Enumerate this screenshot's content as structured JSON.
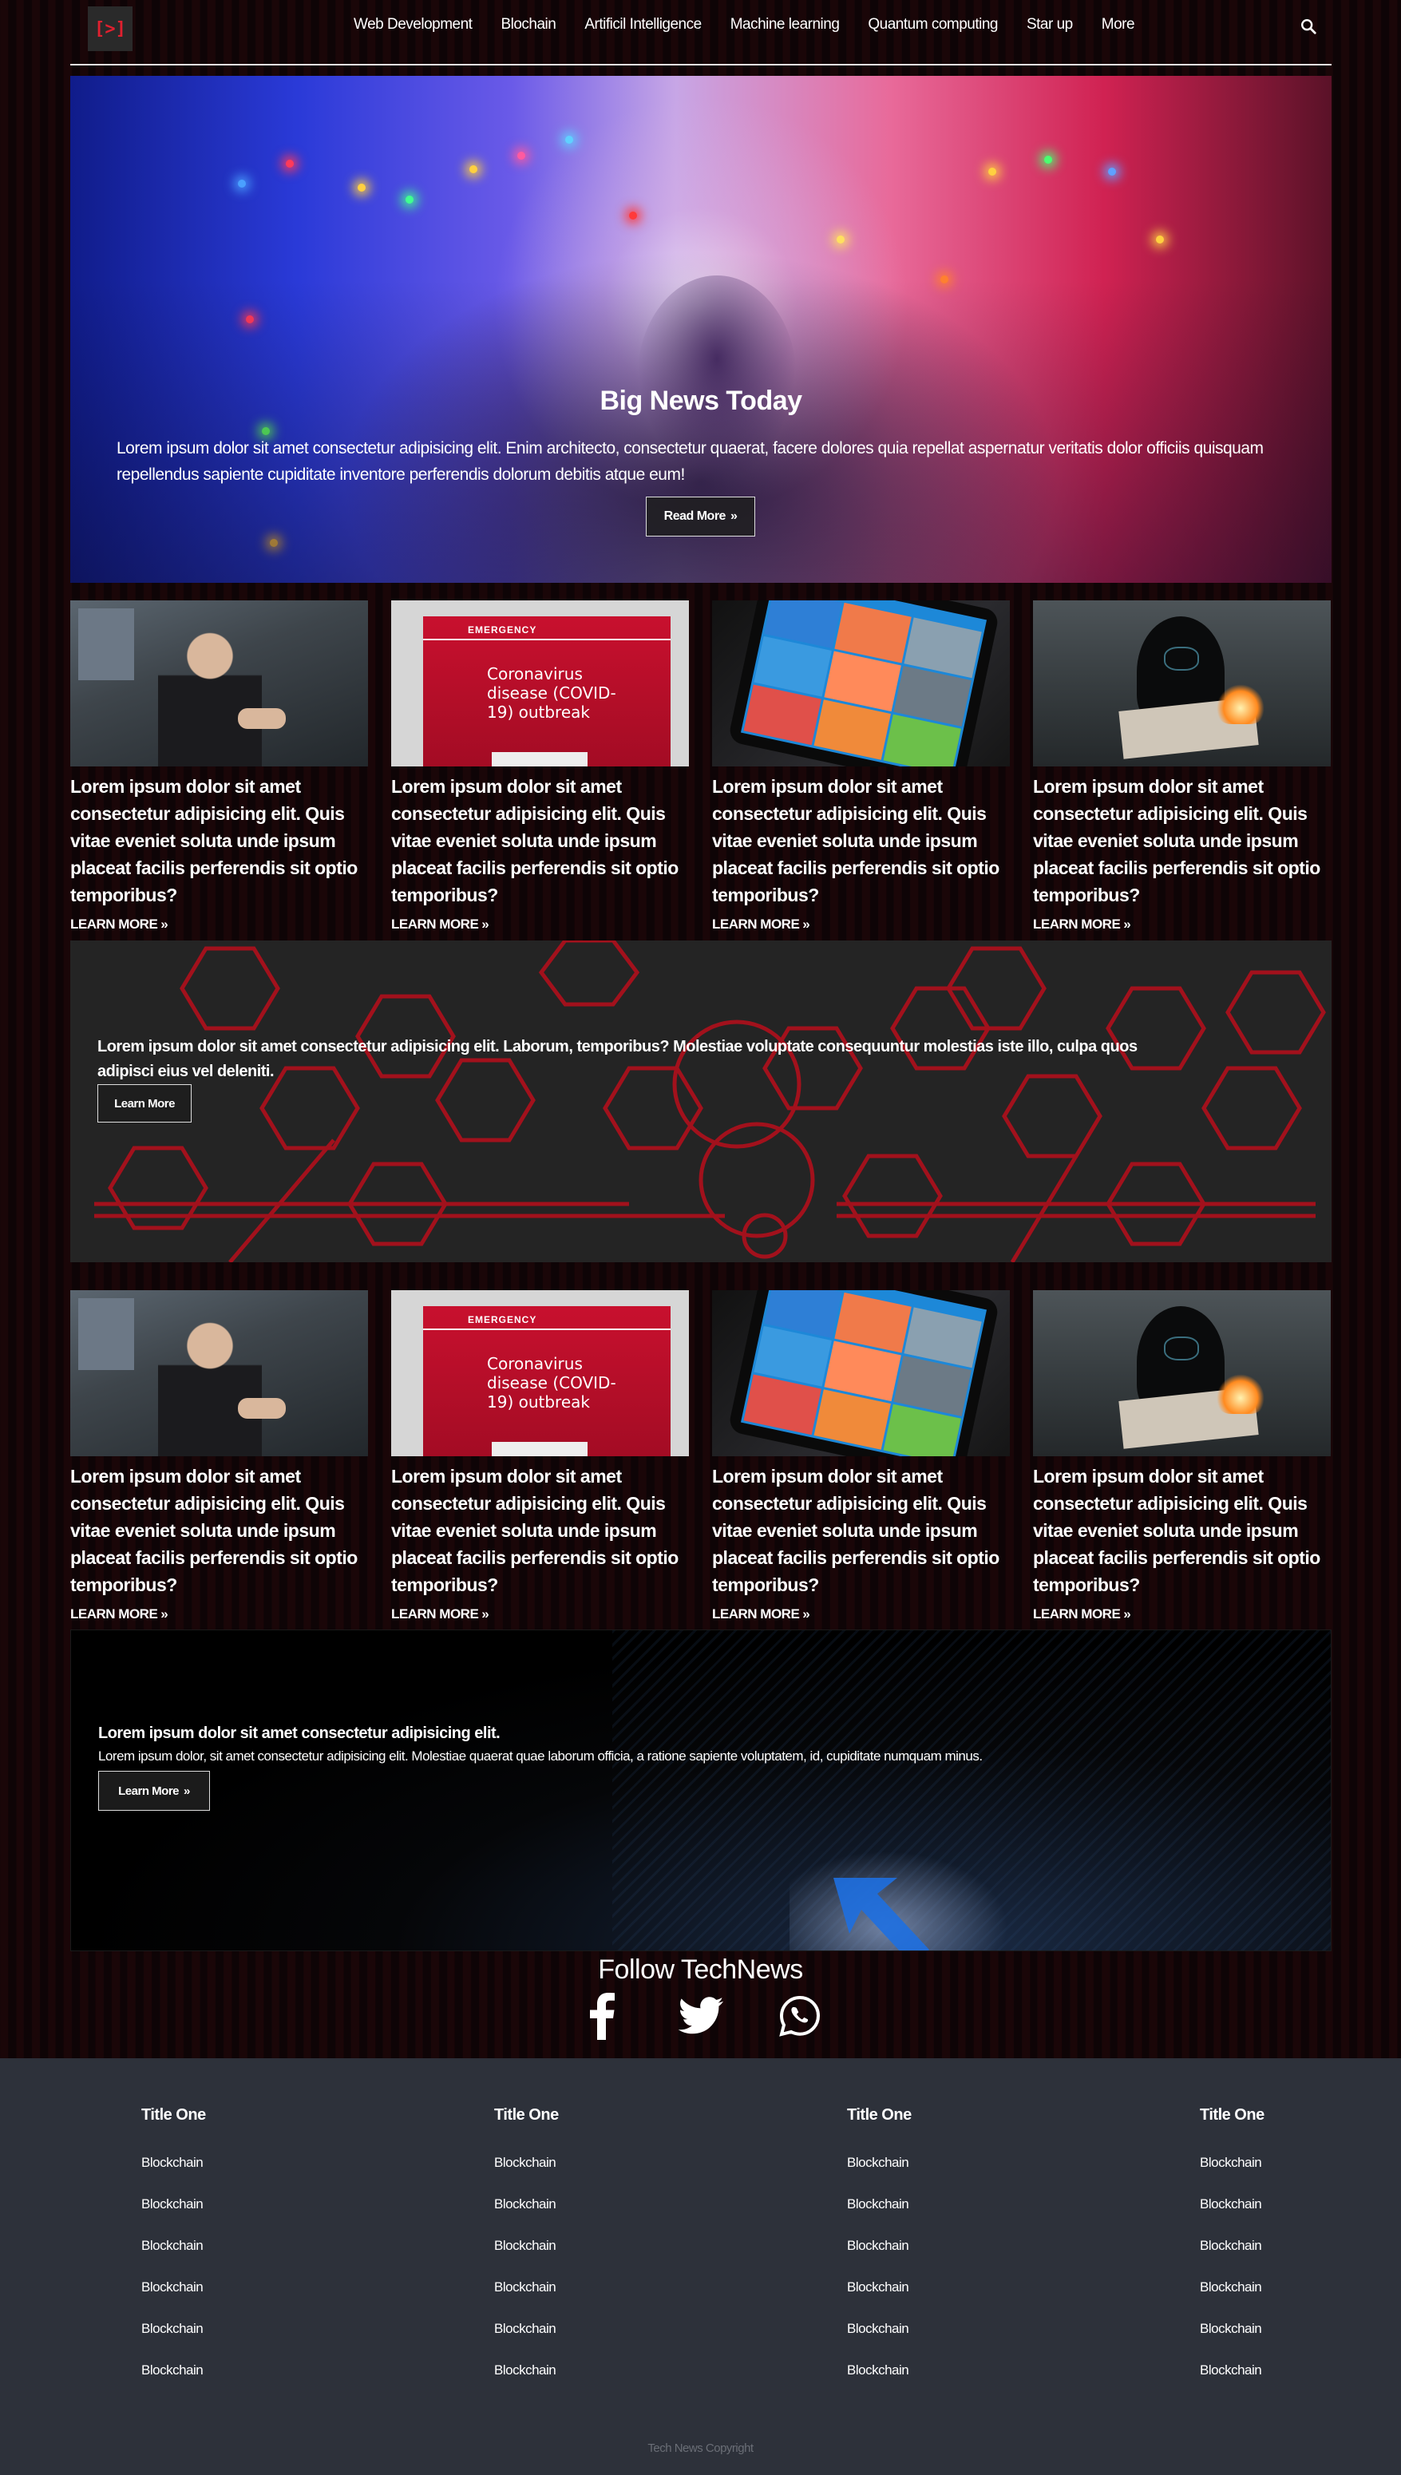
{
  "nav": {
    "logo": "[>]",
    "items": [
      "Web Development",
      "Blochain",
      "Artificil Intelligence",
      "Machine learning",
      "Quantum computing",
      "Star up",
      "More"
    ],
    "search_icon": "search-icon"
  },
  "hero": {
    "title": "Big News Today",
    "text": "Lorem ipsum dolor sit amet consectetur adipisicing elit. Enim architecto, consectetur quaerat, facere dolores quia repellat aspernatur veritatis dolor officiis quisquam repellendus sapiente cupiditate inventore perferendis dolorum debitis atque eum!",
    "button": "Read More"
  },
  "cards_row1": [
    {
      "title": "Lorem ipsum dolor sit amet consectetur adipisicing elit. Quis vitae eveniet soluta unde ipsum placeat facilis perferendis sit optio temporibus?",
      "more": "LEARN MORE"
    },
    {
      "title": "Lorem ipsum dolor sit amet consectetur adipisicing elit. Quis vitae eveniet soluta unde ipsum placeat facilis perferendis sit optio temporibus?",
      "more": "LEARN MORE"
    },
    {
      "title": "Lorem ipsum dolor sit amet consectetur adipisicing elit. Quis vitae eveniet soluta unde ipsum placeat facilis perferendis sit optio temporibus?",
      "more": "LEARN MORE"
    },
    {
      "title": "Lorem ipsum dolor sit amet consectetur adipisicing elit. Quis vitae eveniet soluta unde ipsum placeat facilis perferendis sit optio temporibus?",
      "more": "LEARN MORE"
    }
  ],
  "covid_image": {
    "label": "EMERGENCY",
    "line1": "Coronavirus",
    "line2": "disease (COVID-",
    "line3": "19) outbreak"
  },
  "banner1": {
    "text": "Lorem ipsum dolor sit amet consectetur adipisicing elit. Laborum, temporibus? Molestiae voluptate consequuntur molestias iste illo, culpa quos adipisci eius vel deleniti.",
    "button": "Learn More"
  },
  "cards_row2": [
    {
      "title": "Lorem ipsum dolor sit amet consectetur adipisicing elit. Quis vitae eveniet soluta unde ipsum placeat facilis perferendis sit optio temporibus?",
      "more": "LEARN MORE"
    },
    {
      "title": "Lorem ipsum dolor sit amet consectetur adipisicing elit. Quis vitae eveniet soluta unde ipsum placeat facilis perferendis sit optio temporibus?",
      "more": "LEARN MORE"
    },
    {
      "title": "Lorem ipsum dolor sit amet consectetur adipisicing elit. Quis vitae eveniet soluta unde ipsum placeat facilis perferendis sit optio temporibus?",
      "more": "LEARN MORE"
    },
    {
      "title": "Lorem ipsum dolor sit amet consectetur adipisicing elit. Quis vitae eveniet soluta unde ipsum placeat facilis perferendis sit optio temporibus?",
      "more": "LEARN MORE"
    }
  ],
  "banner2": {
    "title": "Lorem ipsum dolor sit amet consectetur adipisicing elit.",
    "text": "Lorem ipsum dolor, sit amet consectetur adipisicing elit. Molestiae quaerat quae laborum officia, a ratione sapiente voluptatem, id, cupiditate numquam minus.",
    "button": "Learn More"
  },
  "follow": {
    "title": "Follow TechNews",
    "icons": [
      "facebook-icon",
      "twitter-icon",
      "whatsapp-icon"
    ]
  },
  "footer": {
    "columns": [
      {
        "title": "Title One",
        "links": [
          "Blockchain",
          "Blockchain",
          "Blockchain",
          "Blockchain",
          "Blockchain",
          "Blockchain"
        ]
      },
      {
        "title": "Title One",
        "links": [
          "Blockchain",
          "Blockchain",
          "Blockchain",
          "Blockchain",
          "Blockchain",
          "Blockchain"
        ]
      },
      {
        "title": "Title One",
        "links": [
          "Blockchain",
          "Blockchain",
          "Blockchain",
          "Blockchain",
          "Blockchain",
          "Blockchain"
        ]
      },
      {
        "title": "Title One",
        "links": [
          "Blockchain",
          "Blockchain",
          "Blockchain",
          "Blockchain",
          "Blockchain",
          "Blockchain"
        ]
      }
    ],
    "copyright": "Tech News Copyright"
  },
  "colors": {
    "accent": "#e0202f",
    "footer_bg": "#2d313a",
    "hex_red": "#b0101c"
  }
}
